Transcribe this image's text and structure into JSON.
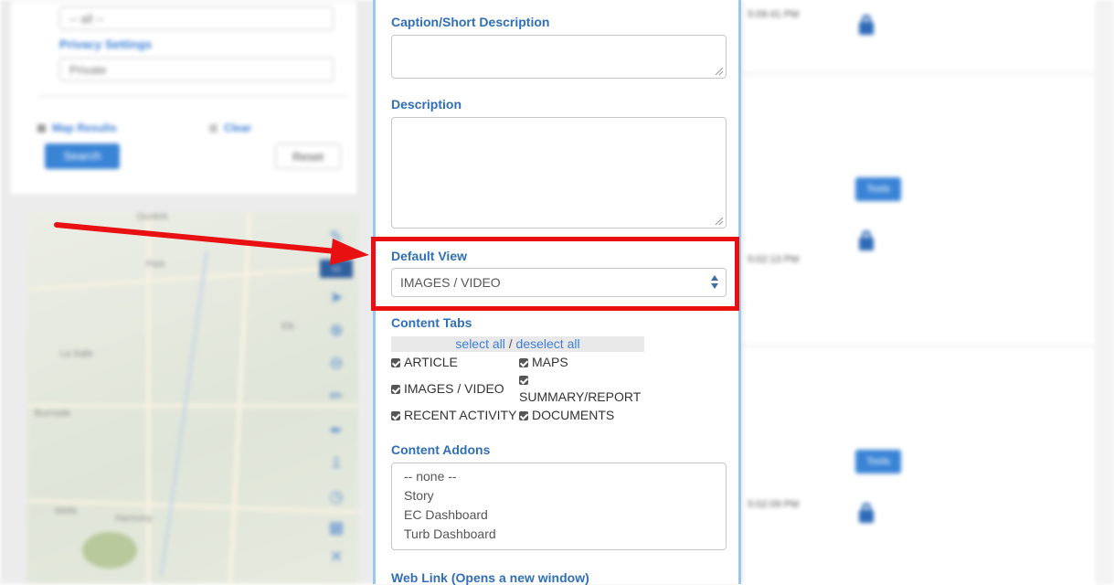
{
  "background": {
    "filter_select_value": "-- all --",
    "privacy_label": "Privacy Settings",
    "privacy_value": "Private",
    "map_results_label": "Map Results",
    "clear_label": "Clear",
    "search_button": "Search",
    "reset_button": "Reset",
    "map_places": [
      "Dunkirk",
      "Park",
      "Elk",
      "La Salle",
      "Burnside",
      "Harmony",
      "Wells"
    ],
    "timestamps": [
      "5:09:41 PM",
      "5:02:13 PM",
      "5:02:09 PM"
    ],
    "tools_label": "Tools"
  },
  "form": {
    "caption_label": "Caption/Short Description",
    "description_label": "Description",
    "default_view_label": "Default View",
    "default_view_value": "IMAGES / VIDEO",
    "content_tabs_label": "Content Tabs",
    "select_all": "select all",
    "divider": " / ",
    "deselect_all": "deselect all",
    "tabs": {
      "article": "ARTICLE",
      "maps": "MAPS",
      "images_video": "IMAGES / VIDEO",
      "summary_report": "SUMMARY/REPORT",
      "recent_activity": "RECENT ACTIVITY",
      "documents": "DOCUMENTS"
    },
    "content_addons_label": "Content Addons",
    "addons": [
      "-- none --",
      "Story",
      "EC Dashboard",
      "Turb Dashboard"
    ],
    "web_link_label": "Web Link (Opens a new window)"
  },
  "colors": {
    "annotation": "#e81010",
    "label_blue": "#2f6fb8",
    "panel_border": "#9ec6e8"
  },
  "icons": [
    "lock-icon",
    "pencil-icon",
    "zoom-in-icon",
    "zoom-out-icon",
    "trash-icon",
    "expand-icon",
    "select-arrows-icon",
    "checkbox-icon",
    "resize-grip-icon"
  ]
}
